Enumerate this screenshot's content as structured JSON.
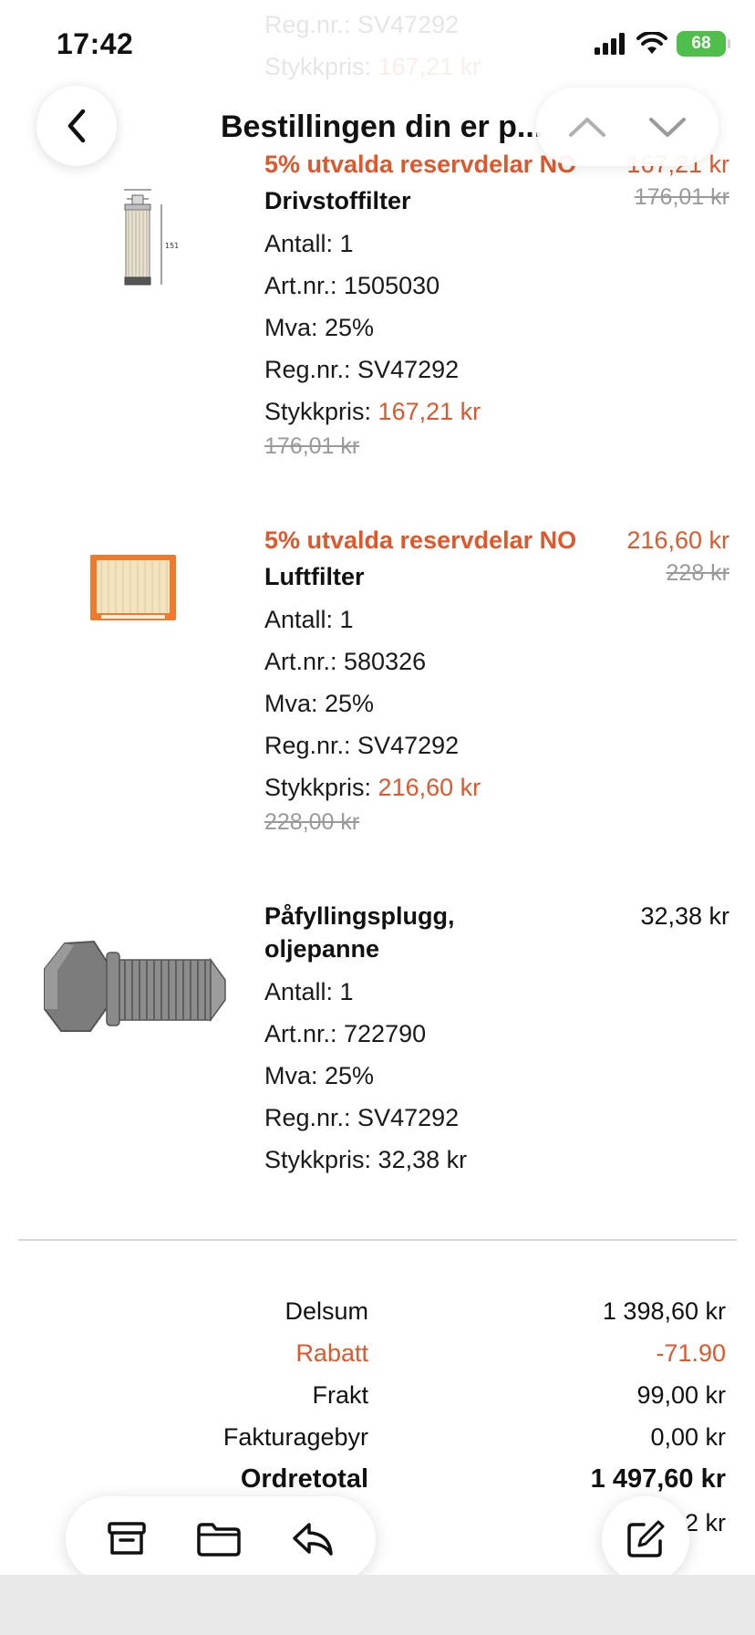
{
  "status_bar": {
    "time": "17:42",
    "battery": "68"
  },
  "background_text": {
    "regnr": "Reg.nr.: SV47292",
    "stykkpris_label": "Stykkpris:",
    "stykkpris_value": "167,21 kr"
  },
  "nav": {
    "title": "Bestillingen din er p..."
  },
  "products": [
    {
      "promo": "5% utvalda reservdelar NO",
      "name": "Drivstoffilter",
      "antall": "Antall: 1",
      "artnr": "Art.nr.: 1505030",
      "mva": "Mva: 25%",
      "regnr": "Reg.nr.: SV47292",
      "stykkpris_label": "Stykkpris:",
      "stykkpris_value": "167,21 kr",
      "stykkpris_old": "176,01 kr",
      "price": "167,21 kr",
      "price_old": "176,01 kr"
    },
    {
      "promo": "5% utvalda reservdelar NO",
      "name": "Luftfilter",
      "antall": "Antall: 1",
      "artnr": "Art.nr.: 580326",
      "mva": "Mva: 25%",
      "regnr": "Reg.nr.: SV47292",
      "stykkpris_label": "Stykkpris:",
      "stykkpris_value": "216,60 kr",
      "stykkpris_old": "228,00 kr",
      "price": "216,60 kr",
      "price_old": "228 kr"
    },
    {
      "name": "Påfyllingsplugg, oljepanne",
      "antall": "Antall: 1",
      "artnr": "Art.nr.: 722790",
      "mva": "Mva: 25%",
      "regnr": "Reg.nr.: SV47292",
      "stykkpris_label": "Stykkpris:",
      "stykkpris_value": "32,38 kr",
      "price": "32,38 kr"
    }
  ],
  "totals": {
    "delsum_label": "Delsum",
    "delsum": "1 398,60 kr",
    "rabatt_label": "Rabatt",
    "rabatt": "-71.90",
    "frakt_label": "Frakt",
    "frakt": "99,00 kr",
    "faktura_label": "Fakturagebyr",
    "faktura": "0,00 kr",
    "ordretotal_label": "Ordretotal",
    "ordretotal": "1 497,60 kr",
    "mva_partial": "2 kr"
  },
  "colors": {
    "accent": "#e2572a",
    "battery": "#4fbe4a"
  },
  "icons": [
    "chevron-left-icon",
    "chevron-up-icon",
    "chevron-down-icon",
    "archive-icon",
    "folder-icon",
    "reply-icon",
    "compose-icon",
    "signal-icon",
    "wifi-icon"
  ]
}
